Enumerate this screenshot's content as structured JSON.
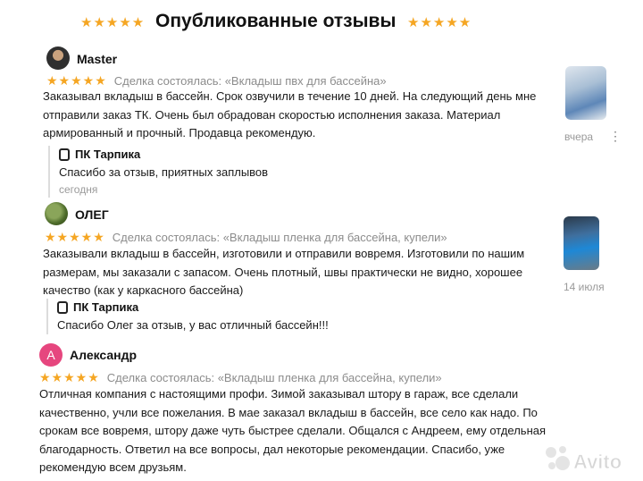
{
  "header": {
    "title": "Опубликованные отзывы",
    "stars": "★★★★★"
  },
  "reviews": [
    {
      "author": "Master",
      "stars": "★★★★★",
      "deal": "Сделка состоялась: «Вкладыш пвх для бассейна»",
      "text": [
        "Заказывал вкладыш в бассейн. Срок озвучили в течение 10 дней. На следующий день мне",
        "отправили заказ ТК. Очень был обрадован скоростью исполнения заказа. Материал",
        "армированный и прочный. Продавца рекомендую."
      ],
      "date": "вчера",
      "reply": {
        "author": "ПК Тарпика",
        "text": "Спасибо за отзыв, приятных заплывов",
        "date": "сегодня"
      }
    },
    {
      "author": "ОЛЕГ",
      "stars": "★★★★★",
      "deal": "Сделка состоялась: «Вкладыш пленка для бассейна, купели»",
      "text": [
        "Заказывали вкладыш в бассейн, изготовили и отправили вовремя. Изготовили по нашим",
        "размерам, мы заказали с запасом. Очень плотный, швы практически не видно, хорошее",
        "качество (как у каркасного бассейна)"
      ],
      "date": "14 июля",
      "reply": {
        "author": "ПК Тарпика",
        "text": "Спасибо Олег за отзыв, у вас отличный бассейн!!!"
      }
    },
    {
      "author": "Александр",
      "avatar_letter": "А",
      "stars": "★★★★★",
      "deal": "Сделка состоялась: «Вкладыш пленка для бассейна, купели»",
      "text": [
        "Отличная компания с настоящими профи. Зимой заказывал штору в гараж, все сделали",
        "качественно, учли все пожелания. В мае заказал вкладыш в бассейн, все село как надо. По",
        "срокам все вовремя, штору даже чуть быстрее сделали. Общался с Андреем, ему отдельная",
        "благодарность. Ответил на все вопросы, дал некоторые рекомендации. Спасибо, уже",
        "рекомендую всем друзьям."
      ]
    }
  ],
  "more_icon": "⋮",
  "watermark": "Avito",
  "colors": {
    "star": "#f5a623",
    "muted": "#8c8c8c",
    "avatar_alex": "#e6467e"
  }
}
